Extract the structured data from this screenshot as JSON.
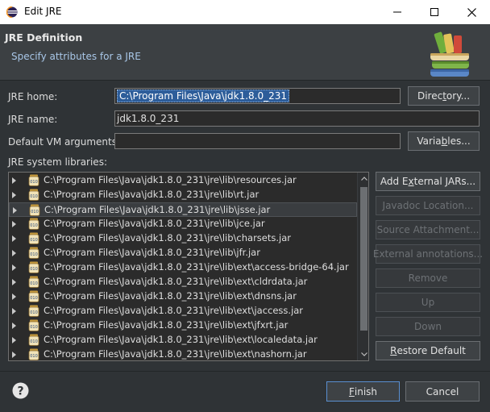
{
  "window": {
    "title": "Edit JRE"
  },
  "header": {
    "title": "JRE Definition",
    "subtitle": "Specify attributes for a JRE"
  },
  "form": {
    "jre_home_label": "JRE home:",
    "jre_home_value": "C:\\Program Files\\Java\\jdk1.8.0_231",
    "jre_name_label": "JRE name:",
    "jre_name_value": "jdk1.8.0_231",
    "vm_args_label": "Default VM arguments:",
    "vm_args_value": "",
    "libraries_label": "JRE system libraries:"
  },
  "buttons": {
    "directory": {
      "pre": "Direc",
      "mn": "t",
      "post": "ory..."
    },
    "variables": {
      "pre": "Varia",
      "mn": "b",
      "post": "les..."
    },
    "add_external_jars": {
      "pre": "Add E",
      "mn": "x",
      "post": "ternal JARs..."
    },
    "javadoc_location": "Javadoc Location...",
    "source_attachment": "Source Attachment...",
    "external_annotations": "External annotations...",
    "remove": "Remove",
    "up": "Up",
    "down": "Down",
    "restore_default": {
      "pre": "",
      "mn": "R",
      "post": "estore Default"
    },
    "finish": {
      "pre": "",
      "mn": "F",
      "post": "inish"
    },
    "cancel": "Cancel"
  },
  "libraries": [
    "C:\\Program Files\\Java\\jdk1.8.0_231\\jre\\lib\\resources.jar",
    "C:\\Program Files\\Java\\jdk1.8.0_231\\jre\\lib\\rt.jar",
    "C:\\Program Files\\Java\\jdk1.8.0_231\\jre\\lib\\jsse.jar",
    "C:\\Program Files\\Java\\jdk1.8.0_231\\jre\\lib\\jce.jar",
    "C:\\Program Files\\Java\\jdk1.8.0_231\\jre\\lib\\charsets.jar",
    "C:\\Program Files\\Java\\jdk1.8.0_231\\jre\\lib\\jfr.jar",
    "C:\\Program Files\\Java\\jdk1.8.0_231\\jre\\lib\\ext\\access-bridge-64.jar",
    "C:\\Program Files\\Java\\jdk1.8.0_231\\jre\\lib\\ext\\cldrdata.jar",
    "C:\\Program Files\\Java\\jdk1.8.0_231\\jre\\lib\\ext\\dnsns.jar",
    "C:\\Program Files\\Java\\jdk1.8.0_231\\jre\\lib\\ext\\jaccess.jar",
    "C:\\Program Files\\Java\\jdk1.8.0_231\\jre\\lib\\ext\\jfxrt.jar",
    "C:\\Program Files\\Java\\jdk1.8.0_231\\jre\\lib\\ext\\localedata.jar",
    "C:\\Program Files\\Java\\jdk1.8.0_231\\jre\\lib\\ext\\nashorn.jar"
  ],
  "selected_library_index": 2,
  "icons": {
    "app": "eclipse-icon",
    "minimize": "minimize-icon",
    "maximize": "maximize-icon",
    "close": "close-icon",
    "banner": "library-books-icon",
    "jar": "jar-icon",
    "expand": "chevron-right-icon",
    "help": "help-icon"
  },
  "colors": {
    "dialog_bg": "#2f3336",
    "header_bg": "#3c4043",
    "subtitle": "#a9c7e8",
    "selection": "#2d5d9a",
    "default_button_border": "#5a8fd0"
  }
}
